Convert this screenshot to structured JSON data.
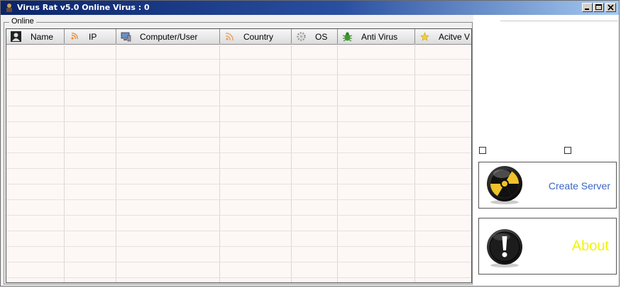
{
  "window": {
    "title": "Virus Rat v5.0 Online Virus : 0"
  },
  "group": {
    "label": "Online"
  },
  "table": {
    "columns": [
      {
        "label": "Name",
        "icon": "user-icon"
      },
      {
        "label": "IP",
        "icon": "rss-icon"
      },
      {
        "label": "Computer/User",
        "icon": "computer-icon"
      },
      {
        "label": "Country",
        "icon": "wifi-icon"
      },
      {
        "label": "OS",
        "icon": "gear-icon"
      },
      {
        "label": "Anti Virus",
        "icon": "bug-icon"
      },
      {
        "label": "Acitve V",
        "icon": "star-icon"
      }
    ],
    "row_count": 16
  },
  "panel": {
    "create_server_label": "Create Server",
    "about_label": "About",
    "create_server_icon": "radiation-icon",
    "about_icon": "exclamation-icon"
  },
  "colors": {
    "titlebar_start": "#0a246a",
    "titlebar_end": "#a6caf0",
    "create_server_text": "#3a66c4",
    "about_text": "#f4f400"
  }
}
